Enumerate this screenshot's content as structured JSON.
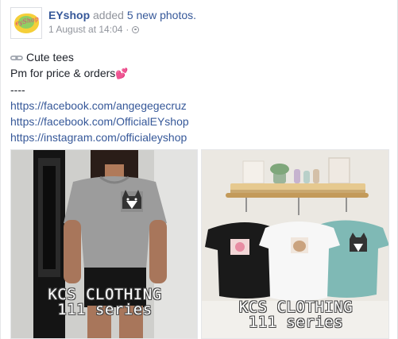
{
  "post": {
    "page_name": "EYshop",
    "action_prefix": "added",
    "action_count": "5 new photos.",
    "timestamp": "1 August at 14:04",
    "separator": "·",
    "avatar_text": "eyShop",
    "icons": {
      "privacy": "globe-icon",
      "link": "link-icon",
      "heart": "heart-icon"
    },
    "body": {
      "title": "Cute tees",
      "line2": "Pm for price & orders",
      "heart": "💕",
      "divider": "----",
      "links": [
        "https://facebook.com/angegegecruz",
        "https://facebook.com/OfficialEYshop",
        "https://instagram.com/officialeyshop"
      ]
    },
    "photos": [
      {
        "watermark_line1": "KCS CLOTHING",
        "watermark_line2": "111 series"
      },
      {
        "watermark_line1": "KCS CLOTHING",
        "watermark_line2": "111 series"
      }
    ],
    "colors": {
      "link": "#365899",
      "meta": "#90949c",
      "text": "#1d2129"
    }
  }
}
